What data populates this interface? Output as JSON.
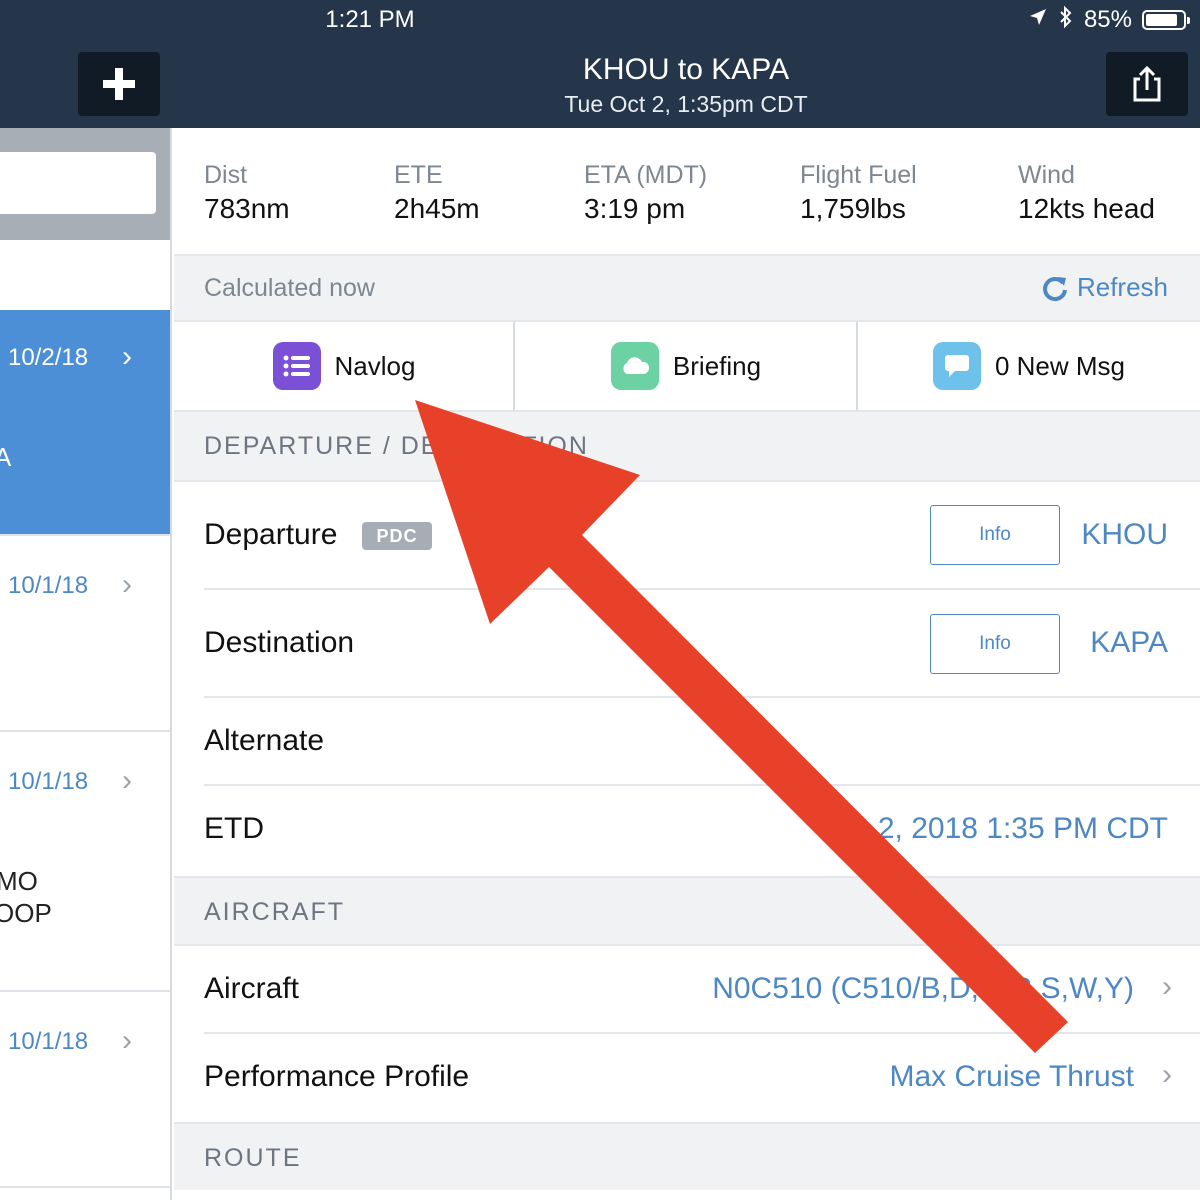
{
  "status_bar": {
    "time": "1:21 PM",
    "battery": "85%",
    "battery_level": 0.85
  },
  "nav": {
    "title": "KHOU to KAPA",
    "subtitle": "Tue Oct 2, 1:35pm CDT"
  },
  "sidebar": {
    "items": [
      {
        "date": "10/2/18",
        "text": "A",
        "selected": true
      },
      {
        "date": "10/1/18",
        "text": ""
      },
      {
        "date": "10/1/18",
        "text_line1": "MO",
        "text_line2": "OOP"
      },
      {
        "date": "10/1/18",
        "text": ""
      }
    ]
  },
  "stats": [
    {
      "label": "Dist",
      "value": "783nm"
    },
    {
      "label": "ETE",
      "value": "2h45m"
    },
    {
      "label": "ETA (MDT)",
      "value": "3:19 pm"
    },
    {
      "label": "Flight Fuel",
      "value": "1,759lbs"
    },
    {
      "label": "Wind",
      "value": "12kts head"
    }
  ],
  "calc": {
    "text": "Calculated now",
    "refresh_label": "Refresh"
  },
  "actions": [
    {
      "label": "Navlog",
      "icon": "list-icon",
      "color": "#7b4fd6"
    },
    {
      "label": "Briefing",
      "icon": "cloud-icon",
      "color": "#6cd1a3"
    },
    {
      "label": "0 New Msg",
      "icon": "chat-icon",
      "color": "#6ec1ea"
    }
  ],
  "sections": {
    "departure": {
      "title": "DEPARTURE / DESTINATION",
      "rows": [
        {
          "label": "Departure",
          "badge": "PDC",
          "button": "Info",
          "value": "KHOU"
        },
        {
          "label": "Destination",
          "button": "Info",
          "value": "KAPA"
        },
        {
          "label": "Alternate",
          "value": ""
        },
        {
          "label": "ETD",
          "value": "Oct 2, 2018 1:35 PM CDT"
        }
      ]
    },
    "aircraft": {
      "title": "AIRCRAFT",
      "rows": [
        {
          "label": "Aircraft",
          "value": "N0C510 (C510/B,D,G,R,S,W,Y)"
        },
        {
          "label": "Performance Profile",
          "value": "Max Cruise Thrust"
        }
      ]
    },
    "route": {
      "title": "ROUTE"
    }
  },
  "colors": {
    "nav_bg": "#25354a",
    "accent": "#4d88c4",
    "selected": "#4c8fd6",
    "arrow": "#e8412a"
  }
}
